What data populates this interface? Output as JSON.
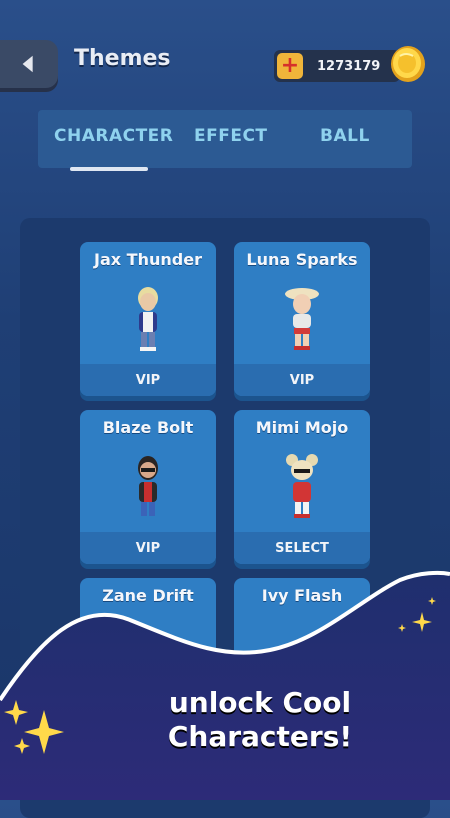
{
  "header": {
    "title": "Themes",
    "coins": "1273179"
  },
  "tabs": [
    {
      "label": "CHARACTER",
      "active": true
    },
    {
      "label": "EFFECT",
      "active": false
    },
    {
      "label": "BALL",
      "active": false
    }
  ],
  "characters": [
    {
      "name": "Jax Thunder",
      "status": "VIP"
    },
    {
      "name": "Luna Sparks",
      "status": "VIP"
    },
    {
      "name": "Blaze Bolt",
      "status": "VIP"
    },
    {
      "name": "Mimi Mojo",
      "status": "SELECT"
    },
    {
      "name": "Zane Drift",
      "status": ""
    },
    {
      "name": "Ivy Flash",
      "status": ""
    }
  ],
  "promo": {
    "line1": "unlock Cool",
    "line2": "Characters!"
  },
  "colors": {
    "background": "#1f3f75",
    "card": "#2f7ec4",
    "tab_text": "#8fd2ee",
    "coin": "#f0b53a"
  },
  "icons": [
    "back-arrow-icon",
    "plus-icon",
    "coin-icon",
    "sparkle-icon"
  ]
}
